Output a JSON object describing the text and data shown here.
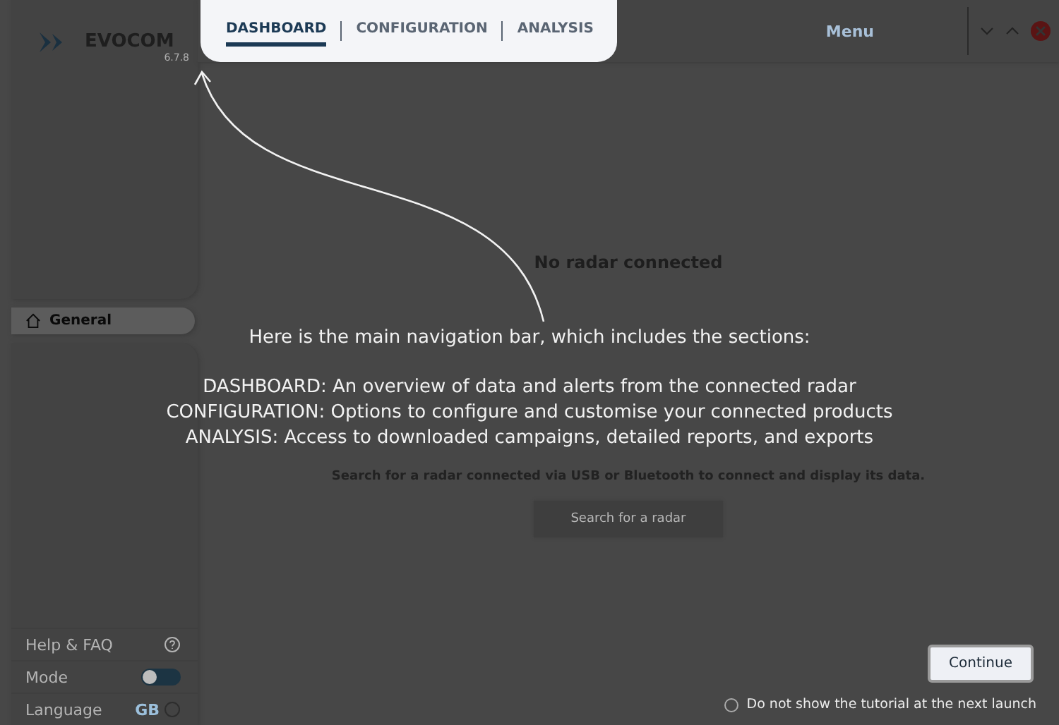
{
  "app": {
    "name": "EVOCOM",
    "version": "6.7.8"
  },
  "tabs": [
    {
      "label": "DASHBOARD",
      "selected": true
    },
    {
      "label": "CONFIGURATION",
      "selected": false
    },
    {
      "label": "ANALYSIS",
      "selected": false
    }
  ],
  "menu": {
    "label": "Menu"
  },
  "sidebar": {
    "items": [
      {
        "label": "General",
        "selected": true
      }
    ],
    "help": {
      "label": "Help & FAQ"
    },
    "mode": {
      "label": "Mode",
      "on": false
    },
    "language": {
      "label": "Language",
      "value": "GB"
    }
  },
  "main": {
    "title": "No radar connected",
    "description": "Search for a radar connected via USB or Bluetooth to connect and display its data.",
    "button": "Search for a radar"
  },
  "tutorial": {
    "intro": "Here is the main navigation bar, which includes the sections:",
    "lines": [
      "DASHBOARD: An overview of data and alerts from the connected radar",
      "CONFIGURATION: Options to configure and customise your connected products",
      "ANALYSIS: Access to downloaded campaigns, detailed reports, and exports"
    ],
    "continue": "Continue",
    "dont_show": {
      "label": "Do not show the tutorial at the next launch",
      "checked": false
    }
  }
}
